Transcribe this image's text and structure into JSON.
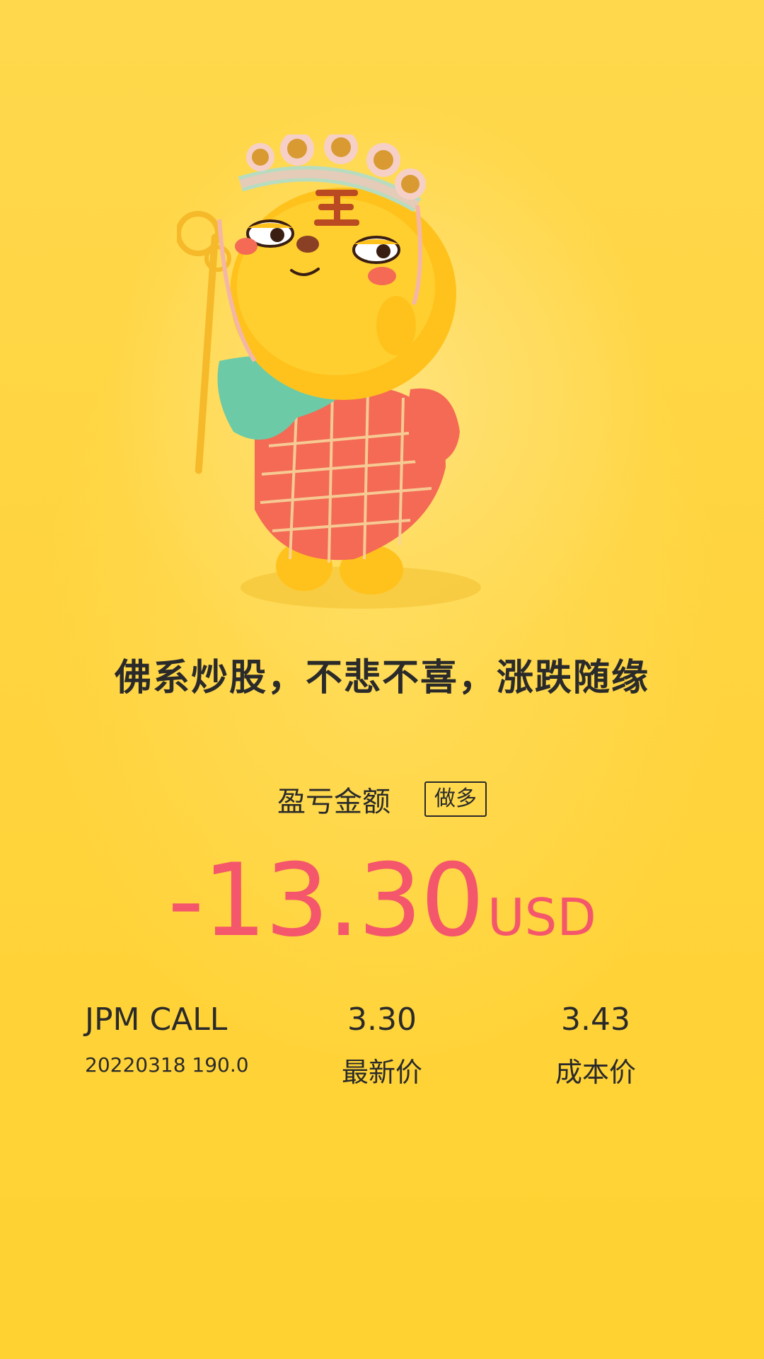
{
  "tagline": "佛系炒股，不悲不喜，涨跌随缘",
  "pnl": {
    "label": "盈亏金额",
    "direction_tag": "做多",
    "amount": "-13.30",
    "currency": "USD",
    "amount_color": "#F4566B"
  },
  "position": {
    "name": "JPM CALL",
    "contract": "20220318 190.0",
    "latest_price": "3.30",
    "latest_price_label": "最新价",
    "cost_price": "3.43",
    "cost_price_label": "成本价"
  },
  "mascot": {
    "icon": "tiger-mascot-illustration"
  }
}
